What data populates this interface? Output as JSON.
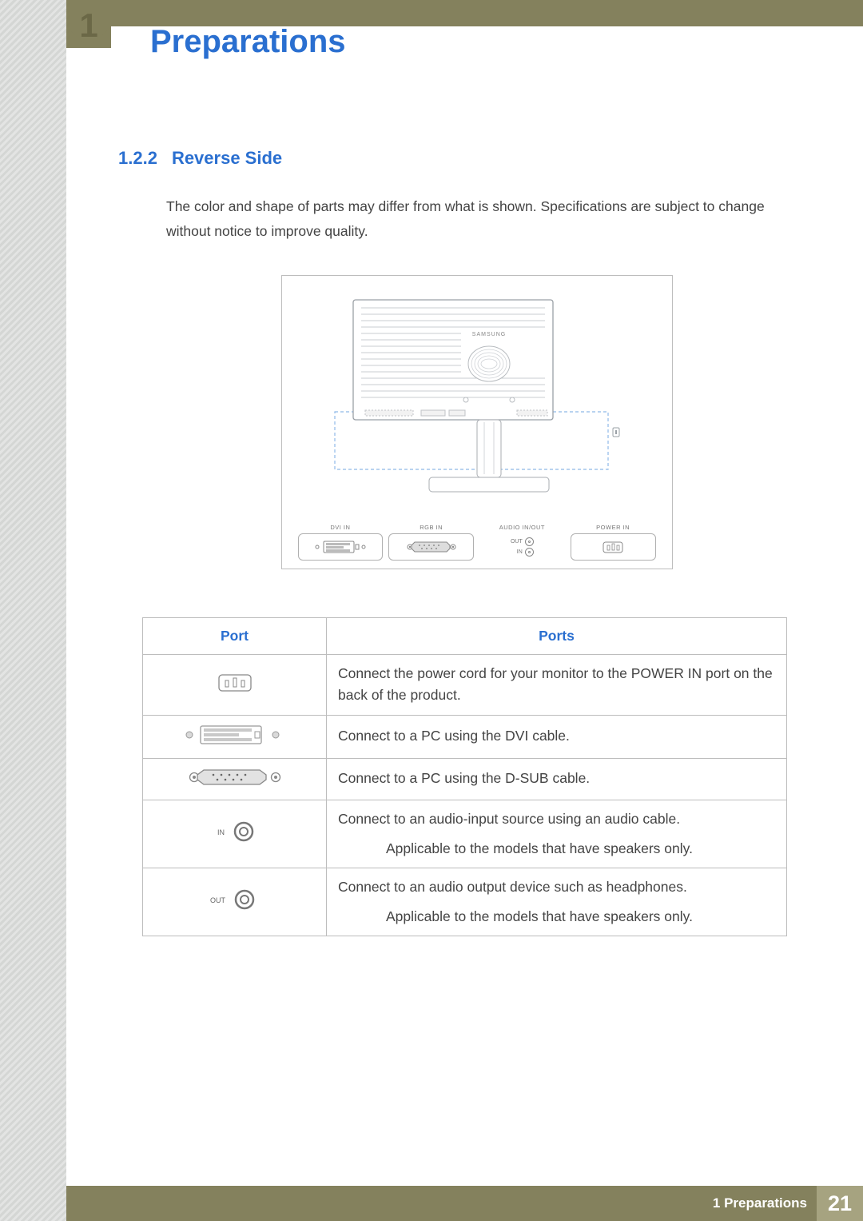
{
  "header": {
    "chapter_number": "1",
    "title": "Preparations"
  },
  "section": {
    "number": "1.2.2",
    "title": "Reverse Side"
  },
  "intro": "The color and shape of parts may differ from what is shown. Specifications are subject to change without notice to improve quality.",
  "diagram": {
    "brand": "SAMSUNG",
    "port_labels": {
      "dvi": "DVI IN",
      "rgb": "RGB IN",
      "audio": "AUDIO IN/OUT",
      "audio_out": "OUT",
      "audio_in": "IN",
      "power": "POWER IN"
    }
  },
  "table": {
    "headers": {
      "port": "Port",
      "desc": "Ports"
    },
    "rows": [
      {
        "icon": "power-in-icon",
        "desc": "Connect the power cord for your monitor to the POWER IN port on the back of the product."
      },
      {
        "icon": "dvi-icon",
        "desc": "Connect to a PC using the DVI cable."
      },
      {
        "icon": "dsub-icon",
        "desc": "Connect to a PC using the D-SUB cable."
      },
      {
        "icon": "audio-in-icon",
        "icon_label": "IN",
        "desc": "Connect to an audio-input source using an audio cable.",
        "note": "Applicable to the models that have speakers only."
      },
      {
        "icon": "audio-out-icon",
        "icon_label": "OUT",
        "desc": "Connect to an audio output device such as headphones.",
        "note": "Applicable to the models that have speakers only."
      }
    ]
  },
  "footer": {
    "label": "1 Preparations",
    "page": "21"
  }
}
